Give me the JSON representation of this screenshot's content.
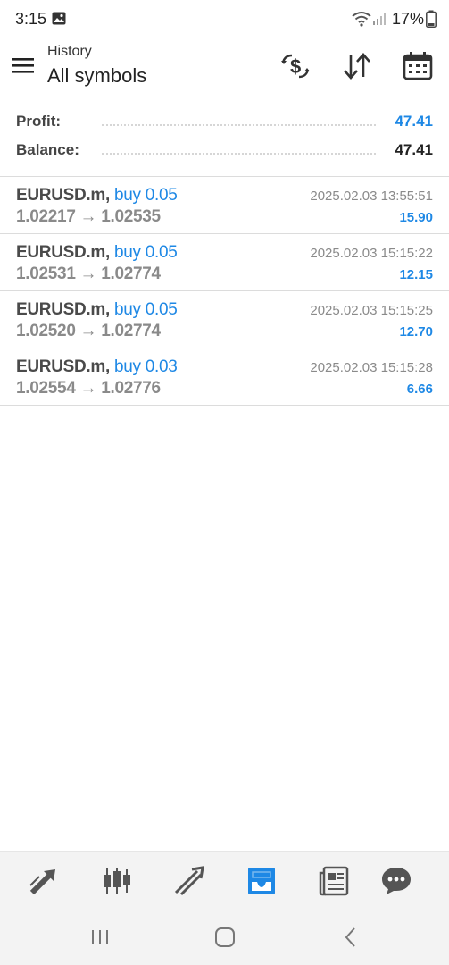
{
  "status_bar": {
    "time": "3:15",
    "battery": "17%"
  },
  "header": {
    "subtitle": "History",
    "title": "All symbols"
  },
  "summary": {
    "profit_label": "Profit:",
    "profit_value": "47.41",
    "balance_label": "Balance:",
    "balance_value": "47.41"
  },
  "deals": [
    {
      "symbol": "EURUSD.m",
      "action": "buy 0.05",
      "prices": "1.02217 → 1.02535",
      "time": "2025.02.03 13:55:51",
      "profit": "15.90"
    },
    {
      "symbol": "EURUSD.m",
      "action": "buy 0.05",
      "prices": "1.02531 → 1.02774",
      "time": "2025.02.03 15:15:22",
      "profit": "12.15"
    },
    {
      "symbol": "EURUSD.m",
      "action": "buy 0.05",
      "prices": "1.02520 → 1.02774",
      "time": "2025.02.03 15:15:25",
      "profit": "12.70"
    },
    {
      "symbol": "EURUSD.m",
      "action": "buy 0.03",
      "prices": "1.02554 → 1.02776",
      "time": "2025.02.03 15:15:28",
      "profit": "6.66"
    }
  ],
  "bottom_nav": {
    "items": [
      {
        "icon": "quotes-icon"
      },
      {
        "icon": "chart-icon"
      },
      {
        "icon": "trade-icon"
      },
      {
        "icon": "history-icon",
        "active": true
      },
      {
        "icon": "news-icon"
      },
      {
        "icon": "chat-icon"
      }
    ]
  },
  "colors": {
    "accent": "#1e88e5",
    "text_dark": "#222222",
    "text_muted": "#8a8a8a",
    "nav_bg": "#f3f3f3"
  }
}
